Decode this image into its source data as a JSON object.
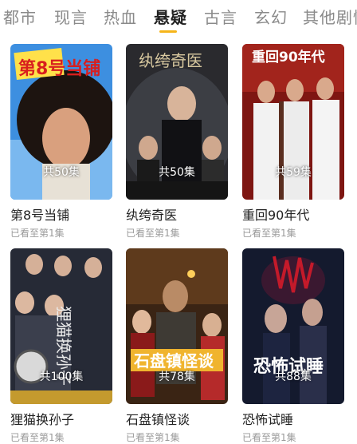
{
  "tabs": [
    {
      "label": "都市",
      "active": false
    },
    {
      "label": "现言",
      "active": false
    },
    {
      "label": "热血",
      "active": false
    },
    {
      "label": "悬疑",
      "active": true
    },
    {
      "label": "古言",
      "active": false
    },
    {
      "label": "玄幻",
      "active": false
    },
    {
      "label": "其他剧情",
      "active": false
    }
  ],
  "accent_color": "#f6b51a",
  "dramas": [
    {
      "title": "第8号当铺",
      "episodes": "共50集",
      "progress": "已看至第1集",
      "poster_text": "第8号当铺"
    },
    {
      "title": "纨绔奇医",
      "episodes": "共50集",
      "progress": "已看至第1集",
      "poster_text": "纨绔奇医"
    },
    {
      "title": "重回90年代",
      "episodes": "共59集",
      "progress": "已看至第1集",
      "poster_text": "重回90年代"
    },
    {
      "title": "狸猫换孙子",
      "episodes": "共100集",
      "progress": "已看至第1集",
      "poster_text": "狸猫换孙子"
    },
    {
      "title": "石盘镇怪谈",
      "episodes": "共78集",
      "progress": "已看至第1集",
      "poster_text": "石盘镇怪谈"
    },
    {
      "title": "恐怖试睡",
      "episodes": "共88集",
      "progress": "已看至第1集",
      "poster_text": "恐怖试睡"
    }
  ]
}
